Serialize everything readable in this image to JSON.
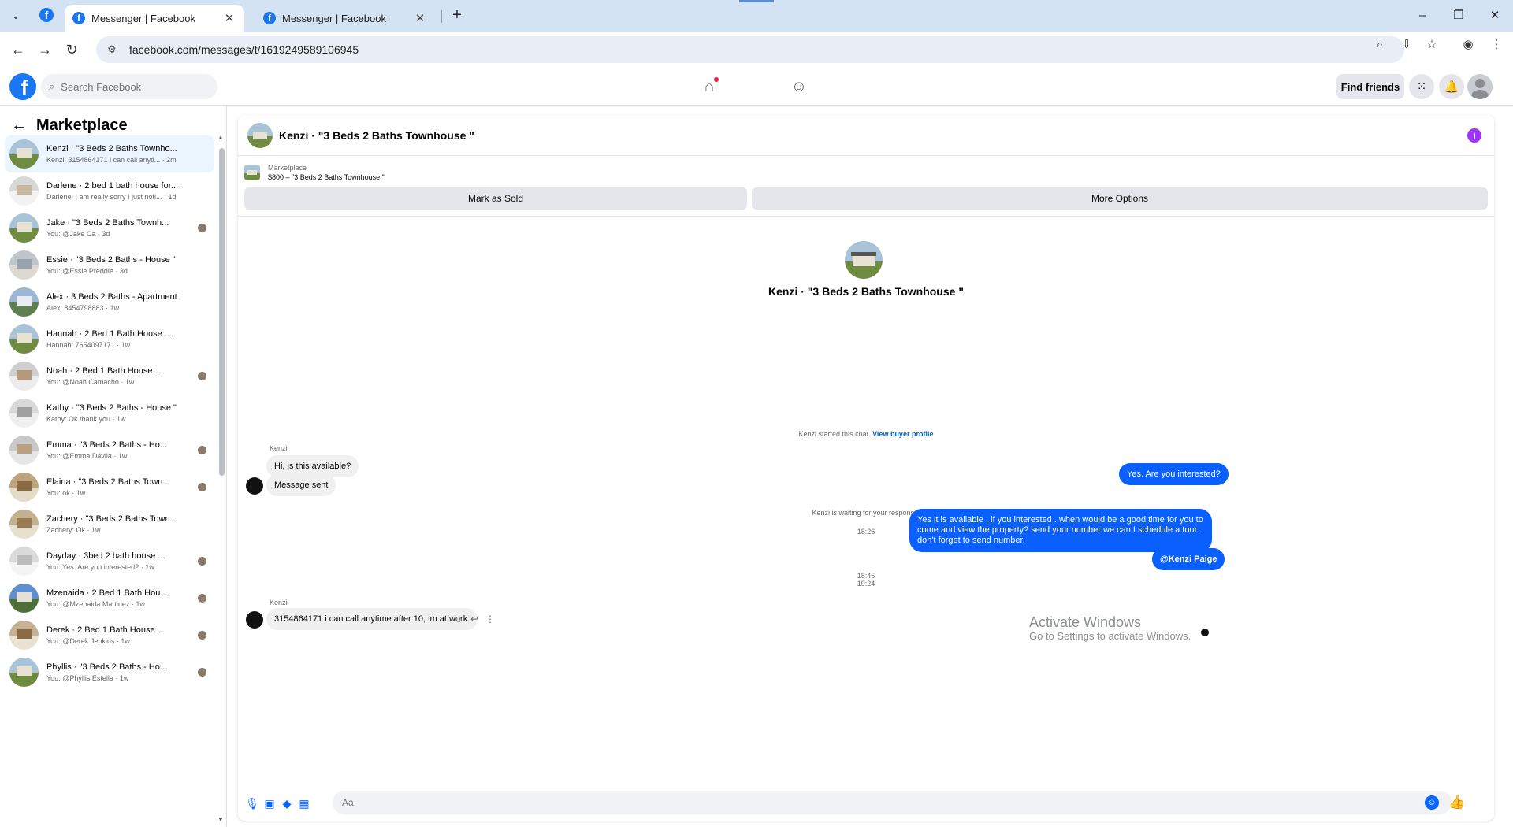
{
  "browser": {
    "tabs": [
      {
        "title": "Messenger | Facebook",
        "close": "✕"
      },
      {
        "title": "Messenger | Facebook",
        "close": "✕"
      }
    ],
    "url": "facebook.com/messages/t/1619249589106945"
  },
  "header": {
    "search_placeholder": "Search Facebook",
    "find_friends": "Find friends"
  },
  "sidebar": {
    "title": "Marketplace",
    "conversations": [
      {
        "name": "Kenzi · \"3 Beds 2 Baths Townho...",
        "preview": "Kenzi: 3154864171 i can call anyti... · 2m",
        "selected": true,
        "seen": false
      },
      {
        "name": "Darlene · 2 bed 1 bath house for...",
        "preview": "Darlene: I am really sorry I just noti... · 1d",
        "seen": false
      },
      {
        "name": "Jake · \"3 Beds 2 Baths Townh...",
        "preview": "You: @Jake Ca · 3d",
        "seen": true
      },
      {
        "name": "Essie · \"3 Beds 2 Baths - House \"",
        "preview": "You: @Essie Preddie · 3d",
        "seen": false
      },
      {
        "name": "Alex · 3 Beds 2 Baths - Apartment",
        "preview": "Alex: 8454798883 · 1w",
        "seen": false
      },
      {
        "name": "Hannah · 2 Bed 1 Bath House ...",
        "preview": "Hannah: 7654097171 · 1w",
        "seen": false
      },
      {
        "name": "Noah · 2 Bed 1 Bath House ...",
        "preview": "You: @Noah Camacho · 1w",
        "seen": true
      },
      {
        "name": "Kathy · \"3 Beds 2 Baths - House \"",
        "preview": "Kathy: Ok thank you · 1w",
        "seen": false
      },
      {
        "name": "Emma · \"3 Beds 2 Baths - Ho...",
        "preview": "You: @Emma Dávila · 1w",
        "seen": true
      },
      {
        "name": "Elaina · \"3 Beds 2 Baths Town...",
        "preview": "You: ok · 1w",
        "seen": true
      },
      {
        "name": "Zachery · \"3 Beds 2 Baths Town...",
        "preview": "Zachery: Ok · 1w",
        "seen": false
      },
      {
        "name": "Dayday · 3bed 2 bath house ...",
        "preview": "You: Yes. Are you interested? · 1w",
        "seen": true
      },
      {
        "name": "Mzenaida · 2 Bed 1 Bath Hou...",
        "preview": "You: @Mzenaida Martinez · 1w",
        "seen": true
      },
      {
        "name": "Derek · 2 Bed 1 Bath House ...",
        "preview": "You: @Derek Jenkins · 1w",
        "seen": true
      },
      {
        "name": "Phyllis · \"3 Beds 2 Baths - Ho...",
        "preview": "You: @Phyllis Estella · 1w",
        "seen": true
      }
    ]
  },
  "chat": {
    "title": "Kenzi · \"3 Beds 2 Baths Townhouse \"",
    "listing_kind": "Marketplace",
    "listing_price": "$800 – \"3 Beds 2 Baths Townhouse \"",
    "mark_sold": "Mark as Sold",
    "more_options": "More Options",
    "profile_name": "Kenzi · \"3 Beds 2 Baths Townhouse \"",
    "started_text": "Kenzi started this chat.",
    "view_buyer": "View buyer profile",
    "sender1": "Kenzi",
    "msg1": "Hi, is this available?",
    "msg2": "Message sent",
    "waiting": "Kenzi is waiting for your response.",
    "time1": "18:26",
    "out1": "Yes. Are you interested?",
    "time2": "18:45",
    "out2": "Yes it is available , if you interested . when would be  a good time for you to come and view the  property? send your number we can I schedule  a tour. don't forget to send  number.",
    "out3": "@Kenzi Paige",
    "time3": "19:24",
    "sender2": "Kenzi",
    "msg3": "3154864171 i can call anytime after 10, im at work.",
    "composer_placeholder": "Aa"
  },
  "watermark": {
    "line1": "Activate Windows",
    "line2": "Go to Settings to activate Windows."
  },
  "colors": {
    "fb_blue": "#1877f2",
    "message_blue": "#0a5fff",
    "bubble_grey": "#f0f0f0"
  }
}
